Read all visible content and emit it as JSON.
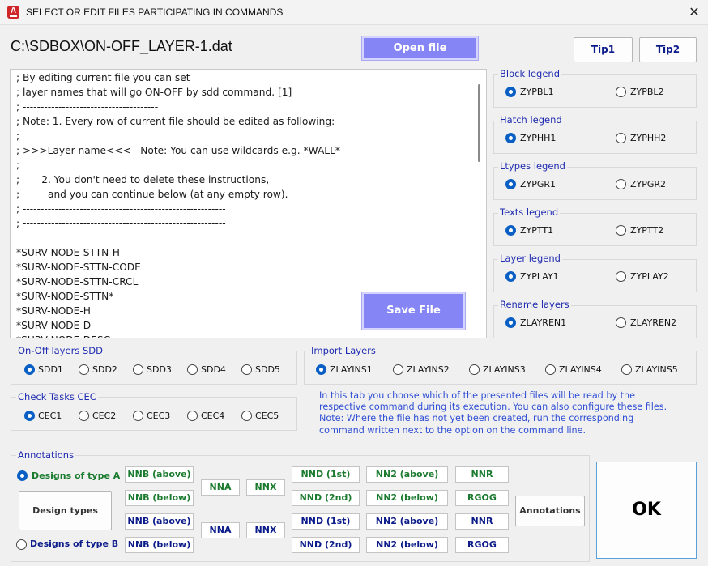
{
  "window": {
    "title": "SELECT OR EDIT FILES PARTICIPATING IN COMMANDS",
    "app_icon_letter": "A"
  },
  "file_path": "C:\\SDBOX\\ON-OFF_LAYER-1.dat",
  "buttons": {
    "open_file": "Open file",
    "save_file": "Save File",
    "tip1": "Tip1",
    "tip2": "Tip2",
    "ok": "OK",
    "design_types": "Design types",
    "annotations": "Annotations"
  },
  "editor_text": "; By editing current file you can set\n; layer names that will go ON-OFF by sdd command. [1]\n; --------------------------------------\n; Note: 1. Every row of current file should be edited as following:\n;\n; >>>Layer name<<<   Note: You can use wildcards e.g. *WALL*\n;\n;       2. You don't need to delete these instructions,\n;         and you can continue below (at any empty row).\n; ---------------------------------------------------------\n; ---------------------------------------------------------\n\n*SURV-NODE-STTN-H\n*SURV-NODE-STTN-CODE\n*SURV-NODE-STTN-CRCL\n*SURV-NODE-STTN*\n*SURV-NODE-H\n*SURV-NODE-D\n*SURV-NODE-DESC",
  "legends": [
    {
      "title": "Block legend",
      "options": [
        "ZYPBL1",
        "ZYPBL2"
      ],
      "selected": 0
    },
    {
      "title": "Hatch legend",
      "options": [
        "ZYPHH1",
        "ZYPHH2"
      ],
      "selected": 0
    },
    {
      "title": "Ltypes legend",
      "options": [
        "ZYPGR1",
        "ZYPGR2"
      ],
      "selected": 0
    },
    {
      "title": "Texts legend",
      "options": [
        "ZYPTT1",
        "ZYPTT2"
      ],
      "selected": 0
    },
    {
      "title": "Layer legend",
      "options": [
        "ZYPLAY1",
        "ZYPLAY2"
      ],
      "selected": 0
    },
    {
      "title": "Rename layers",
      "options": [
        "ZLAYREN1",
        "ZLAYREN2"
      ],
      "selected": 0
    }
  ],
  "onoff": {
    "title": "On-Off layers SDD",
    "options": [
      "SDD1",
      "SDD2",
      "SDD3",
      "SDD4",
      "SDD5"
    ],
    "selected": 0
  },
  "import": {
    "title": "Import Layers",
    "options": [
      "ZLAYINS1",
      "ZLAYINS2",
      "ZLAYINS3",
      "ZLAYINS4",
      "ZLAYINS5"
    ],
    "selected": 0
  },
  "cec": {
    "title": "Check Tasks CEC",
    "options": [
      "CEC1",
      "CEC2",
      "CEC3",
      "CEC4",
      "CEC5"
    ],
    "selected": 0
  },
  "info_text": "In this tab you choose which of the presented files will be read by the respective command during its execution. You can also configure these files. Note: Where the file has not yet been created, run the corresponding command written next to the option on the command line.",
  "annotations": {
    "title": "Annotations",
    "type_a": "Designs of type A",
    "type_b": "Designs of type B",
    "type_selected": "A",
    "row_a1": [
      "NNB (above)",
      "NND (1st)",
      "NN2 (above)",
      "NNR"
    ],
    "row_a2": [
      "NNB (below)",
      "NND (2nd)",
      "NN2 (below)",
      "RGOG"
    ],
    "mid_a": [
      "NNA",
      "NNX"
    ],
    "row_b1": [
      "NNB (above)",
      "NND (1st)",
      "NN2 (above)",
      "NNR"
    ],
    "row_b2": [
      "NNB (below)",
      "NND (2nd)",
      "NN2 (below)",
      "RGOG"
    ],
    "mid_b": [
      "NNA",
      "NNX"
    ]
  },
  "colors": {
    "accent_purple": "#8585f5",
    "label_blue": "#1f2bb0",
    "info_blue": "#2f4ed4",
    "green_text": "#1a7a2e",
    "radio_blue": "#0a5fc4"
  }
}
